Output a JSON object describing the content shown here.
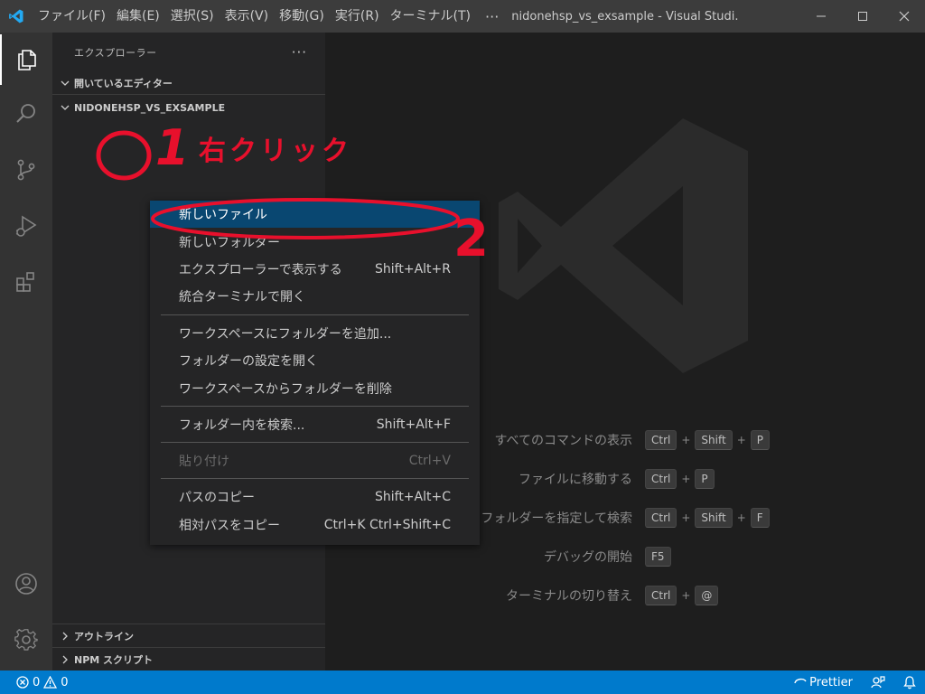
{
  "titlebar": {
    "menus": [
      "ファイル(F)",
      "編集(E)",
      "選択(S)",
      "表示(V)",
      "移動(G)",
      "実行(R)",
      "ターミナル(T)"
    ],
    "more": "···",
    "window_title": "nidonehsp_vs_exsample - Visual Studi...",
    "icons": [
      "vscode-logo-icon",
      "minimize-icon",
      "maximize-icon",
      "close-icon"
    ]
  },
  "activitybar": {
    "items": [
      "explorer-icon",
      "search-icon",
      "source-control-icon",
      "run-debug-icon",
      "extensions-icon",
      "accounts-icon",
      "manage-gear-icon"
    ]
  },
  "sidebar": {
    "title": "エクスプローラー",
    "more": "···",
    "open_editors": "開いているエディター",
    "folder": "NIDONEHSP_VS_EXSAMPLE",
    "outline": "アウトライン",
    "npm_scripts": "NPM スクリプト"
  },
  "context_menu": {
    "items": [
      {
        "label": "新しいファイル",
        "key": ""
      },
      {
        "label": "新しいフォルダー",
        "key": ""
      },
      {
        "label": "エクスプローラーで表示する",
        "key": "Shift+Alt+R"
      },
      {
        "label": "統合ターミナルで開く",
        "key": ""
      },
      {
        "label": "ワークスペースにフォルダーを追加...",
        "key": ""
      },
      {
        "label": "フォルダーの設定を開く",
        "key": ""
      },
      {
        "label": "ワークスペースからフォルダーを削除",
        "key": ""
      },
      {
        "label": "フォルダー内を検索...",
        "key": "Shift+Alt+F"
      },
      {
        "label": "貼り付け",
        "key": "Ctrl+V"
      },
      {
        "label": "パスのコピー",
        "key": "Shift+Alt+C"
      },
      {
        "label": "相対パスをコピー",
        "key": "Ctrl+K Ctrl+Shift+C"
      }
    ],
    "selected_index": 0,
    "disabled_index": 8
  },
  "annotations": {
    "step1_number": "1",
    "step1_text": "右クリック",
    "step2_number": "2",
    "color": "#e8102c"
  },
  "editor": {
    "shortcuts": [
      {
        "label": "すべてのコマンドの表示",
        "keys": [
          "Ctrl",
          "Shift",
          "P"
        ]
      },
      {
        "label": "ファイルに移動する",
        "keys": [
          "Ctrl",
          "P"
        ]
      },
      {
        "label": "フォルダーを指定して検索",
        "keys": [
          "Ctrl",
          "Shift",
          "F"
        ]
      },
      {
        "label": "デバッグの開始",
        "keys": [
          "F5"
        ]
      },
      {
        "label": "ターミナルの切り替え",
        "keys": [
          "Ctrl",
          "@"
        ]
      }
    ],
    "plus": "+"
  },
  "statusbar": {
    "errors": "0",
    "warnings": "0",
    "prettier": "Prettier",
    "icons": [
      "error-icon",
      "warning-icon",
      "prettier-check-icon",
      "feedback-icon",
      "bell-icon"
    ]
  },
  "colors": {
    "accent": "#007acc",
    "selection": "#094771",
    "annotation_red": "#e8102c"
  }
}
